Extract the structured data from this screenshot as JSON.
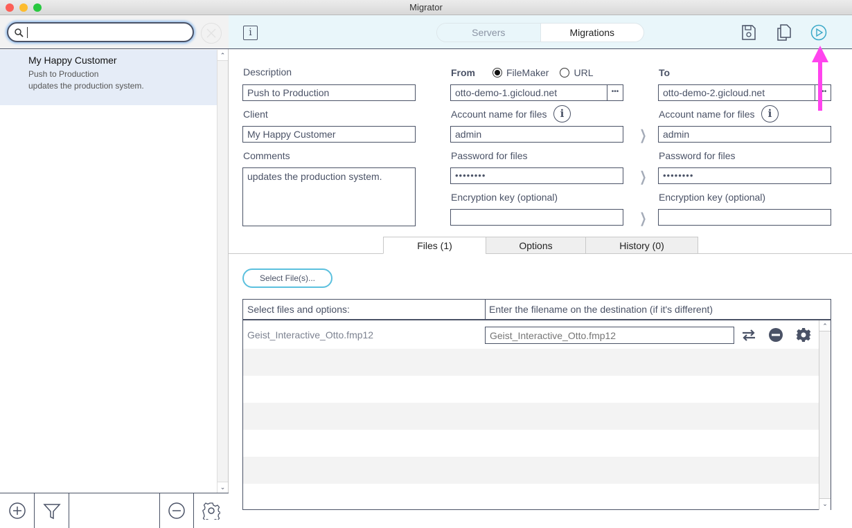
{
  "window": {
    "title": "Migrator"
  },
  "sidebar": {
    "search": {
      "value": "",
      "placeholder": ""
    },
    "items": [
      {
        "title": "My Happy Customer",
        "description": "Push to Production",
        "comment": "updates the production system."
      }
    ]
  },
  "toolbar": {
    "segments": [
      {
        "label": "Servers",
        "selected": false
      },
      {
        "label": "Migrations",
        "selected": true
      }
    ]
  },
  "form": {
    "description_label": "Description",
    "description_value": "Push to Production",
    "client_label": "Client",
    "client_value": "My Happy Customer",
    "comments_label": "Comments",
    "comments_value": "updates the production system.",
    "from": {
      "label": "From",
      "radio_options": [
        {
          "label": "FileMaker",
          "checked": true
        },
        {
          "label": "URL",
          "checked": false
        }
      ],
      "server": "otto-demo-1.gicloud.net",
      "account_label": "Account name for files",
      "account": "admin",
      "password_label": "Password for files",
      "password_mask": "••••••••",
      "encryption_label": "Encryption key (optional)",
      "encryption": ""
    },
    "to": {
      "label": "To",
      "server": "otto-demo-2.gicloud.net",
      "account_label": "Account name for files",
      "account": "admin",
      "password_label": "Password for files",
      "password_mask": "••••••••",
      "encryption_label": "Encryption key (optional)",
      "encryption": ""
    },
    "dots_label": "•••"
  },
  "tabs": [
    {
      "label": "Files (1)",
      "active": true
    },
    {
      "label": "Options",
      "active": false
    },
    {
      "label": "History (0)",
      "active": false
    }
  ],
  "files": {
    "select_button": "Select File(s)...",
    "col1": "Select files and options:",
    "col2": "Enter the filename on the destination (if it's different)",
    "rows": [
      {
        "name": "Geist_Interactive_Otto.fmp12",
        "dest_placeholder": "Geist_Interactive_Otto.fmp12"
      }
    ]
  },
  "annotation": {
    "color": "#ff44ee"
  }
}
